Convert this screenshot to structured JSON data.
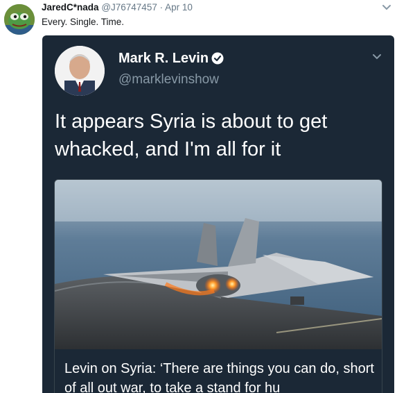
{
  "tweet": {
    "display_name": "JaredC*nada",
    "handle": "@J76747457",
    "separator": "·",
    "date": "Apr 10",
    "text": "Every. Single. Time."
  },
  "quoted": {
    "display_name": "Mark R. Levin",
    "handle": "@marklevinshow",
    "text": "It appears Syria is about to get whacked, and I'm all for it",
    "link_card": {
      "title": "Levin on Syria: ‘There are things you can do, short of all out war, to take a stand for hu"
    }
  },
  "colors": {
    "card_bg": "#1b2836",
    "handle_gray": "#8899a6",
    "verified_blue": "#1da1f2"
  },
  "icons": [
    "frog-avatar",
    "chevron-down-icon",
    "verified-badge-icon",
    "portrait-avatar"
  ]
}
